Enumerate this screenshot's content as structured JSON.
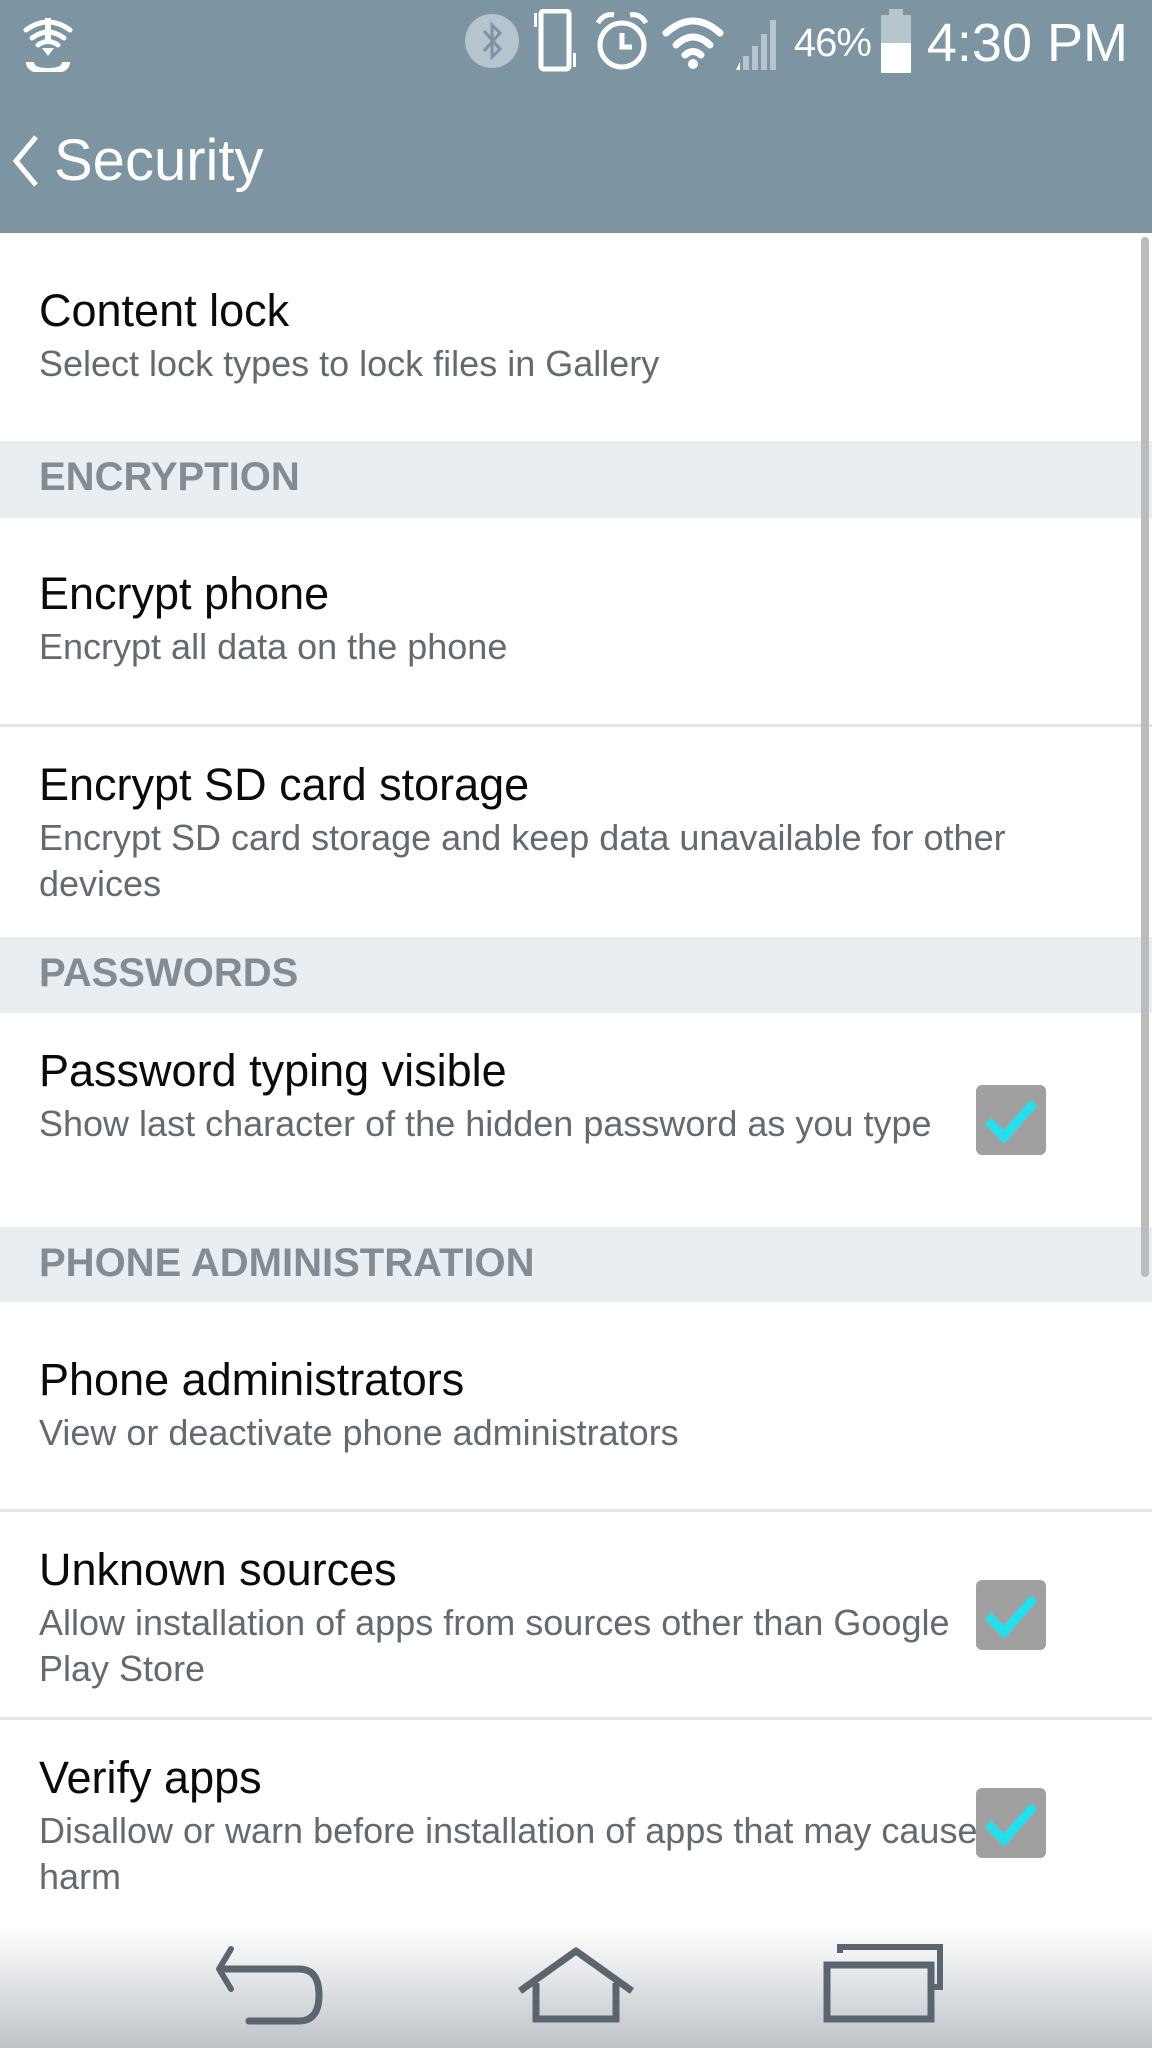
{
  "status_bar": {
    "left_icon": "wifi-call-icon",
    "icons": [
      "bluetooth-icon",
      "vibrate-icon",
      "alarm-icon",
      "wifi-icon",
      "signal-icon"
    ],
    "battery_percent": "46%",
    "battery_level": 0.46,
    "time": "4:30 PM"
  },
  "appbar": {
    "back_icon": "chevron-left-icon",
    "title": "Security"
  },
  "rows": {
    "content_lock": {
      "title": "Content lock",
      "subtitle": "Select lock types to lock files in Gallery"
    },
    "encrypt_phone": {
      "title": "Encrypt phone",
      "subtitle": "Encrypt all data on the phone"
    },
    "encrypt_sd": {
      "title": "Encrypt SD card storage",
      "subtitle": "Encrypt SD card storage and keep data unavailable for other devices"
    },
    "password_visible": {
      "title": "Password typing visible",
      "subtitle": "Show last character of the hidden password as you type",
      "checked": true
    },
    "phone_admins": {
      "title": "Phone administrators",
      "subtitle": "View or deactivate phone administrators"
    },
    "unknown_sources": {
      "title": "Unknown sources",
      "subtitle": "Allow installation of apps from sources other than Google Play Store",
      "checked": true
    },
    "verify_apps": {
      "title": "Verify apps",
      "subtitle": "Disallow or warn before installation of apps that may cause harm",
      "checked": true
    }
  },
  "sections": {
    "encryption": "ENCRYPTION",
    "passwords": "PASSWORDS",
    "phone_admin": "PHONE ADMINISTRATION"
  },
  "navbar": {
    "buttons": [
      "back-icon",
      "home-icon",
      "recent-apps-icon"
    ]
  },
  "colors": {
    "header_bg": "#7d94a3",
    "section_bg": "#e8eef2",
    "section_text": "#848c93",
    "check_accent": "#22e0ee",
    "checkbox_bg": "#a0a0a0"
  }
}
